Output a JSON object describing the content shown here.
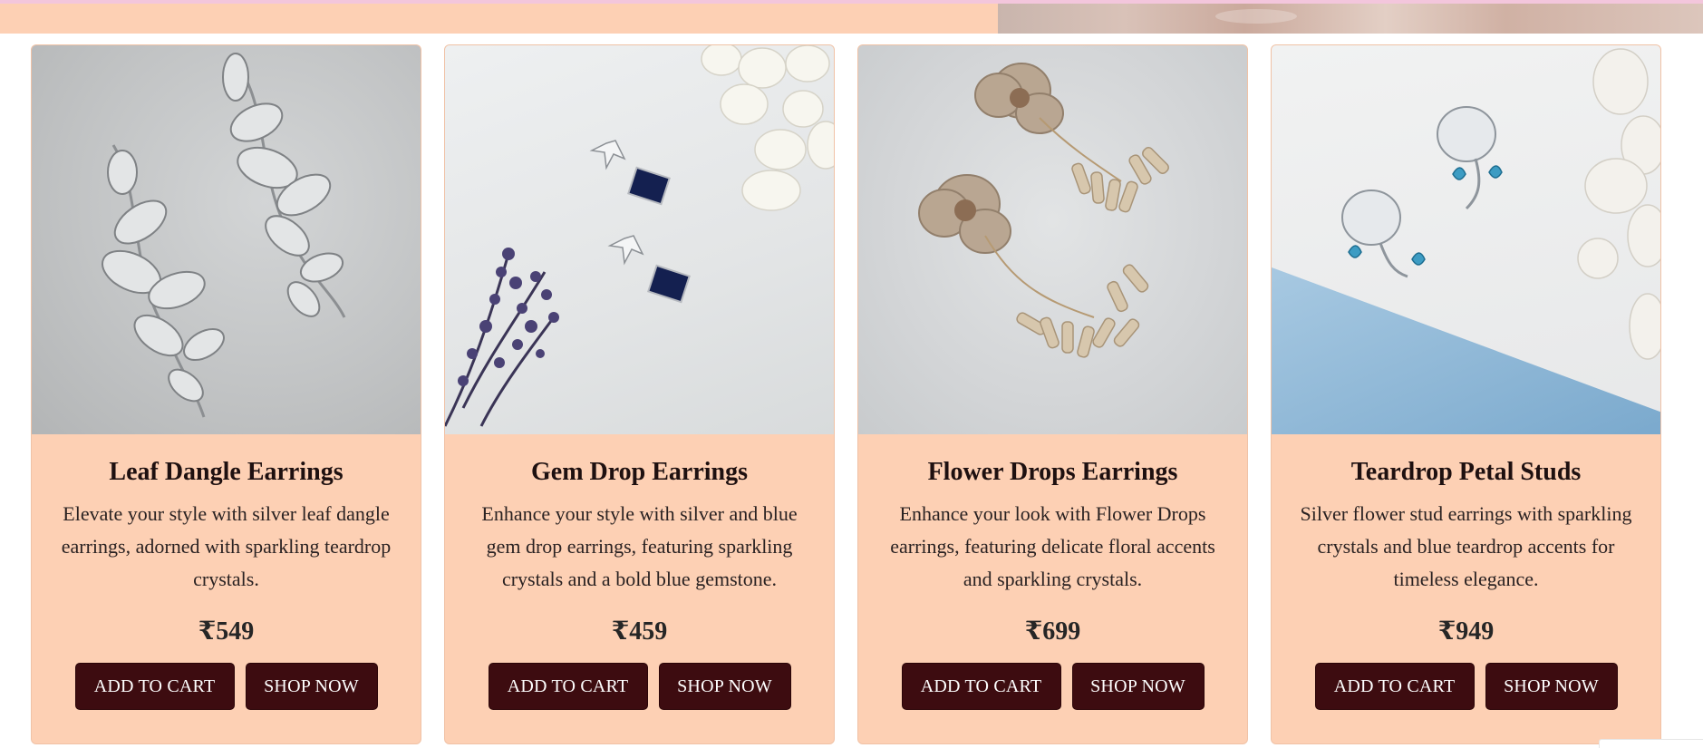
{
  "products": [
    {
      "title": "Leaf Dangle Earrings",
      "description": "Elevate your style with silver leaf dangle earrings, adorned with sparkling teardrop crystals.",
      "price": "₹549",
      "add_to_cart_label": "ADD TO CART",
      "shop_now_label": "SHOP NOW"
    },
    {
      "title": "Gem Drop Earrings",
      "description": "Enhance your style with silver and blue gem drop earrings, featuring sparkling crystals and a bold blue gemstone.",
      "price": "₹459",
      "add_to_cart_label": "ADD TO CART",
      "shop_now_label": "SHOP NOW"
    },
    {
      "title": "Flower Drops Earrings",
      "description": "Enhance your look with Flower Drops earrings, featuring delicate floral accents and sparkling crystals.",
      "price": "₹699",
      "add_to_cart_label": "ADD TO CART",
      "shop_now_label": "SHOP NOW"
    },
    {
      "title": "Teardrop Petal Studs",
      "description": "Silver flower stud earrings with sparkling crystals and blue teardrop accents for timeless elegance.",
      "price": "₹949",
      "add_to_cart_label": "ADD TO CART",
      "shop_now_label": "SHOP NOW"
    }
  ],
  "colors": {
    "card_background": "#fdd0b4",
    "button_background": "#3d0c10",
    "button_text": "#ffffff",
    "top_strip": "#f3c6dc"
  }
}
